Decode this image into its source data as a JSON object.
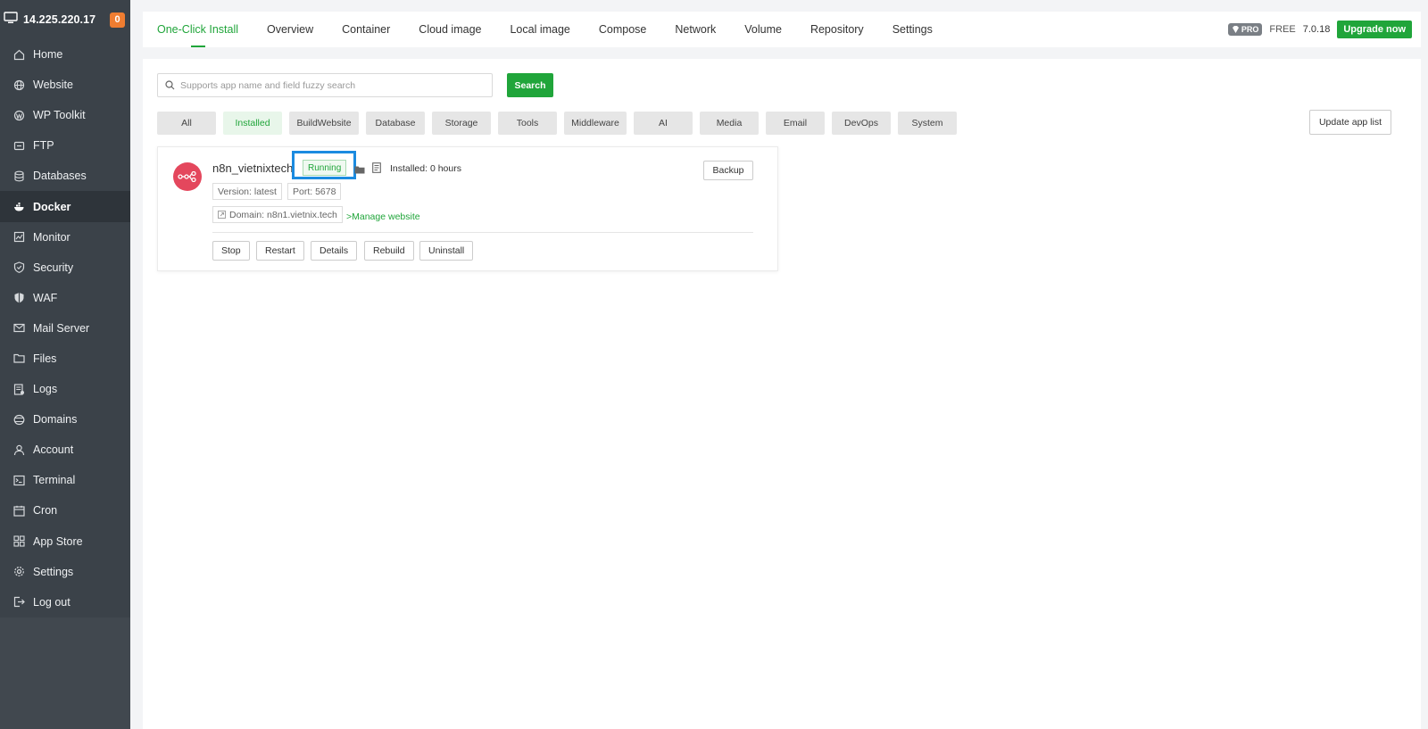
{
  "server": {
    "ip": "14.225.220.17",
    "notifications": "0"
  },
  "sidebar": {
    "items": [
      {
        "label": "Home",
        "icon": "home-icon"
      },
      {
        "label": "Website",
        "icon": "globe-icon"
      },
      {
        "label": "WP Toolkit",
        "icon": "wordpress-icon"
      },
      {
        "label": "FTP",
        "icon": "ftp-icon"
      },
      {
        "label": "Databases",
        "icon": "database-icon"
      },
      {
        "label": "Docker",
        "icon": "docker-icon",
        "active": true
      },
      {
        "label": "Monitor",
        "icon": "monitor-icon"
      },
      {
        "label": "Security",
        "icon": "shield-icon"
      },
      {
        "label": "WAF",
        "icon": "waf-icon"
      },
      {
        "label": "Mail Server",
        "icon": "mail-icon"
      },
      {
        "label": "Files",
        "icon": "folder-icon"
      },
      {
        "label": "Logs",
        "icon": "logs-icon"
      },
      {
        "label": "Domains",
        "icon": "domains-icon"
      },
      {
        "label": "Account",
        "icon": "user-icon"
      },
      {
        "label": "Terminal",
        "icon": "terminal-icon"
      },
      {
        "label": "Cron",
        "icon": "calendar-icon"
      },
      {
        "label": "App Store",
        "icon": "grid-icon"
      },
      {
        "label": "Settings",
        "icon": "gear-icon"
      },
      {
        "label": "Log out",
        "icon": "logout-icon"
      }
    ]
  },
  "tabs": [
    "One-Click Install",
    "Overview",
    "Container",
    "Cloud image",
    "Local image",
    "Compose",
    "Network",
    "Volume",
    "Repository",
    "Settings"
  ],
  "topbar": {
    "pro": "PRO",
    "free": "FREE",
    "version": "7.0.18",
    "upgrade": "Upgrade now"
  },
  "search": {
    "placeholder": "Supports app name and field fuzzy search",
    "button": "Search"
  },
  "categories": [
    "All",
    "Installed",
    "BuildWebsite",
    "Database",
    "Storage",
    "Tools",
    "Middleware",
    "AI",
    "Media",
    "Email",
    "DevOps",
    "System"
  ],
  "active_category": "Installed",
  "update_button": "Update app list",
  "app": {
    "name": "n8n_vietnixtech",
    "status": "Running",
    "installed": "Installed: 0 hours",
    "version": "Version: latest",
    "port": "Port: 5678",
    "domain": "Domain: n8n1.vietnix.tech",
    "manage": ">Manage website",
    "backup": "Backup",
    "actions": [
      "Stop",
      "Restart",
      "Details",
      "Rebuild",
      "Uninstall"
    ]
  },
  "colors": {
    "accent": "#20a53a",
    "sidebar": "#3b4249",
    "highlight": "#1b8be0",
    "app_icon": "#e4475d",
    "badge": "#ef7d31"
  }
}
